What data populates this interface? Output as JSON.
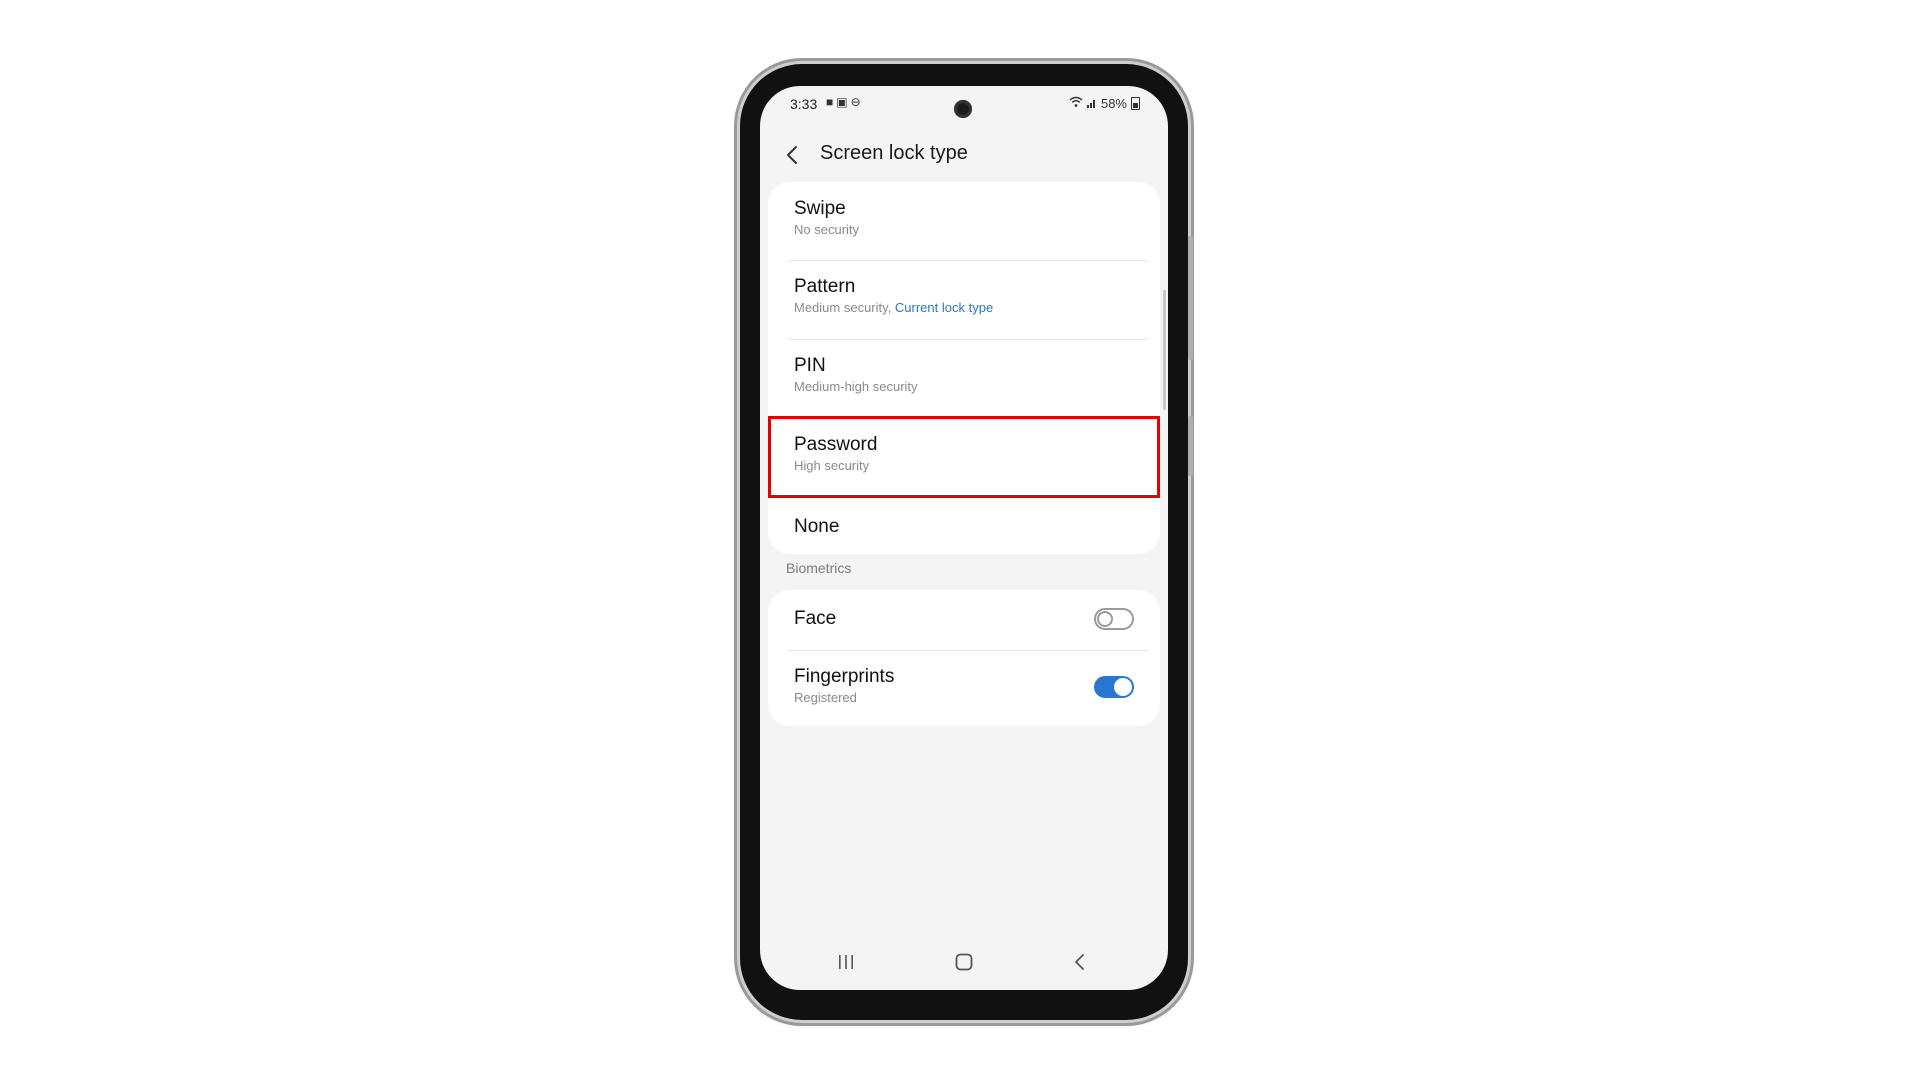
{
  "status_bar": {
    "time": "3:33",
    "left_icons": [
      "video-icon",
      "screenshot-icon",
      "dnd-icon"
    ],
    "battery": "58%"
  },
  "header": {
    "title": "Screen lock type"
  },
  "lock_types": [
    {
      "title": "Swipe",
      "subtitle": "No security"
    },
    {
      "title": "Pattern",
      "subtitle": "Medium security, ",
      "subtitle_accent": "Current lock type"
    },
    {
      "title": "PIN",
      "subtitle": "Medium-high security"
    },
    {
      "title": "Password",
      "subtitle": "High security",
      "highlighted": true
    },
    {
      "title": "None"
    }
  ],
  "biometrics": {
    "section_label": "Biometrics",
    "items": [
      {
        "title": "Face",
        "toggle": false
      },
      {
        "title": "Fingerprints",
        "subtitle": "Registered",
        "toggle": true
      }
    ]
  },
  "colors": {
    "accent": "#2a76d2",
    "highlight": "#e30000",
    "background": "#f4f4f4"
  },
  "navbar": {
    "buttons": [
      "recents-icon",
      "home-icon",
      "back-icon"
    ]
  }
}
